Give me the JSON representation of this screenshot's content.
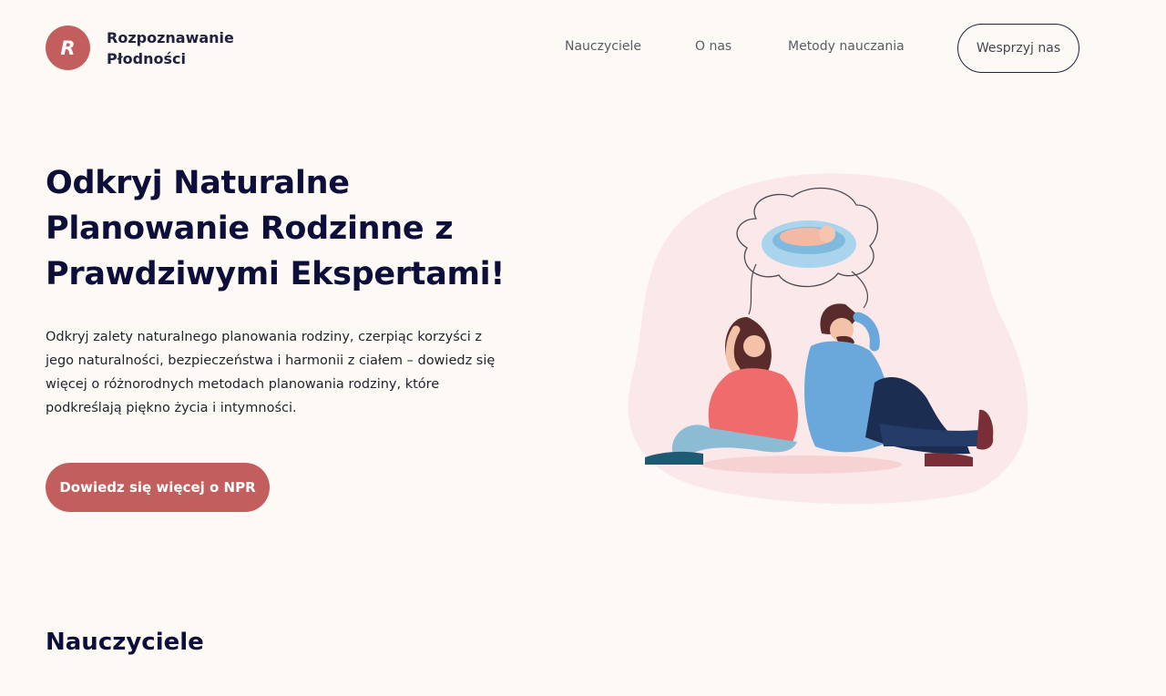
{
  "brand": {
    "logo_letter": "R",
    "name_line1": "Rozpoznawanie",
    "name_line2": "Płodności",
    "accent_color": "#c25e5e",
    "text_color": "#0d0f3a"
  },
  "nav": {
    "items": [
      {
        "label": "Nauczyciele"
      },
      {
        "label": "O nas"
      },
      {
        "label": "Metody nauczania"
      }
    ],
    "support_label": "Wesprzyj nas"
  },
  "hero": {
    "title_lines": [
      "Odkryj Naturalne",
      "Planowanie Rodzinne z",
      "Prawdziwymi Ekspertami!"
    ],
    "description_lines": [
      "Odkryj zalety naturalnego planowania rodziny, czerpiąc korzyści z",
      "jego naturalności, bezpieczeństwa i harmonii z ciałem – dowiedz się",
      "więcej o różnorodnych metodach planowania rodziny, które",
      "podkreślają piękno życia i intymności."
    ],
    "cta_label": "Dowiedz się więcej o NPR",
    "illustration_icon": "couple-thinking-of-baby-illustration"
  },
  "teachers_section": {
    "title": "Nauczyciele"
  }
}
